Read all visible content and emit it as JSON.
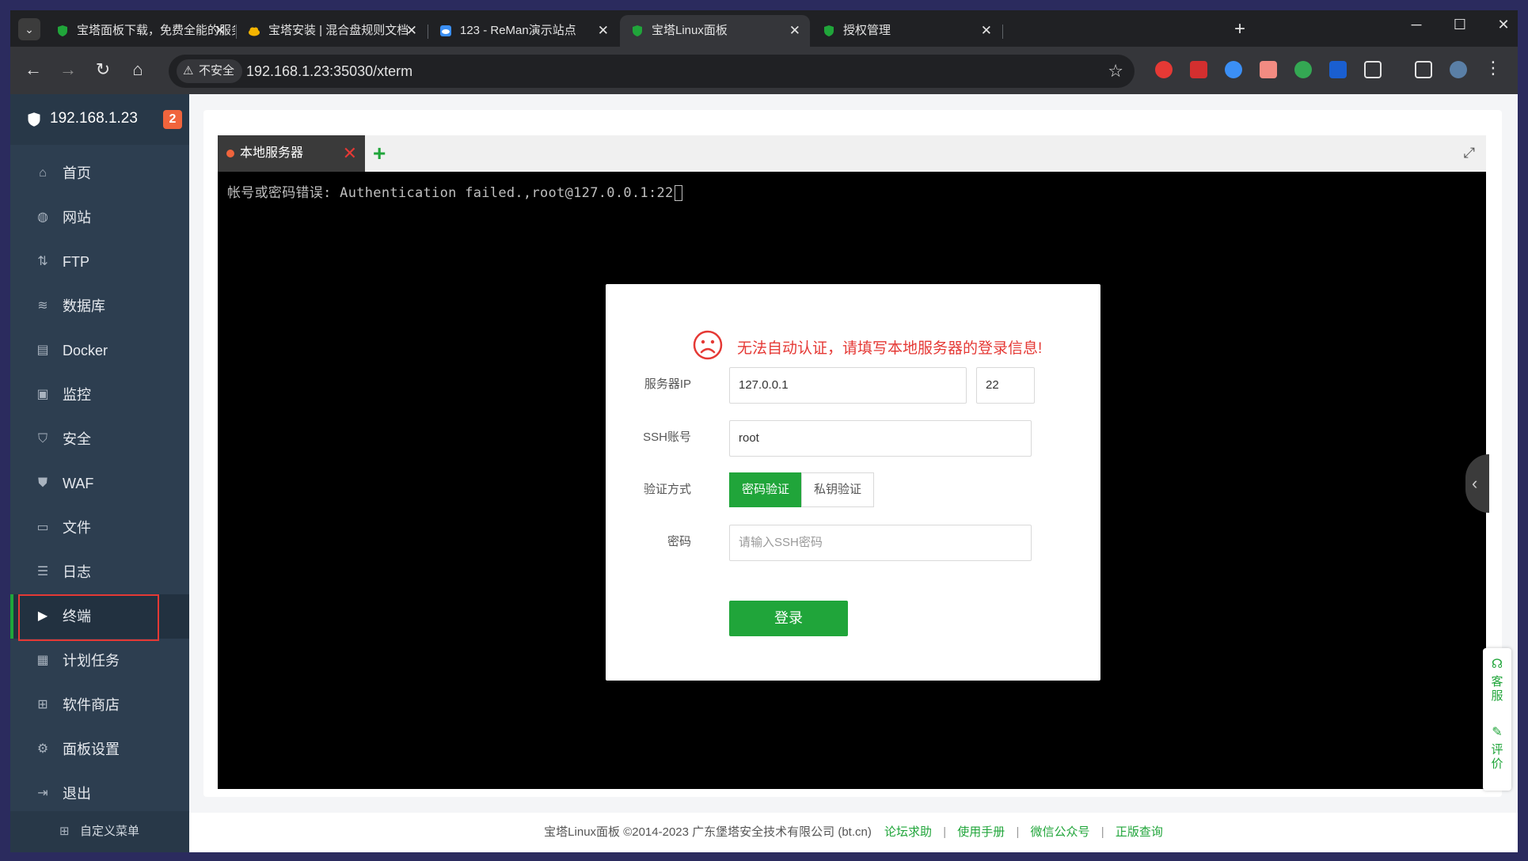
{
  "browser": {
    "tabs": [
      {
        "title": "宝塔面板下载，免费全能的服务",
        "active": false,
        "favicon": "bt-shield-icon"
      },
      {
        "title": "宝塔安装 | 混合盘规则文档",
        "active": false,
        "favicon": "cloud-icon"
      },
      {
        "title": "123 - ReMan演示站点",
        "active": false,
        "favicon": "blue-app-icon"
      },
      {
        "title": "宝塔Linux面板",
        "active": true,
        "favicon": "bt-shield-icon"
      },
      {
        "title": "授权管理",
        "active": false,
        "favicon": "bt-shield-icon"
      }
    ],
    "security_label": "不安全",
    "url": "192.168.1.23:35030/xterm"
  },
  "sidebar": {
    "host": "192.168.1.23",
    "badge": "2",
    "items": [
      {
        "label": "首页",
        "icon": "home-icon"
      },
      {
        "label": "网站",
        "icon": "globe-icon"
      },
      {
        "label": "FTP",
        "icon": "ftp-icon"
      },
      {
        "label": "数据库",
        "icon": "database-icon"
      },
      {
        "label": "Docker",
        "icon": "docker-icon"
      },
      {
        "label": "监控",
        "icon": "monitor-icon"
      },
      {
        "label": "安全",
        "icon": "shield-icon"
      },
      {
        "label": "WAF",
        "icon": "waf-shield-icon"
      },
      {
        "label": "文件",
        "icon": "folder-icon"
      },
      {
        "label": "日志",
        "icon": "log-icon"
      },
      {
        "label": "终端",
        "icon": "terminal-icon",
        "active": true
      },
      {
        "label": "计划任务",
        "icon": "calendar-icon"
      },
      {
        "label": "软件商店",
        "icon": "apps-grid-icon"
      },
      {
        "label": "面板设置",
        "icon": "gear-icon"
      },
      {
        "label": "退出",
        "icon": "logout-icon"
      }
    ],
    "custom_menu": "自定义菜单"
  },
  "terminal": {
    "tab_label": "本地服务器",
    "output": "帐号或密码错误: Authentication failed.,root@127.0.0.1:22"
  },
  "dialog": {
    "message": "无法自动认证，请填写本地服务器的登录信息!",
    "server_ip_label": "服务器IP",
    "server_ip": "127.0.0.1",
    "port": "22",
    "ssh_account_label": "SSH账号",
    "ssh_account": "root",
    "auth_method_label": "验证方式",
    "auth_password": "密码验证",
    "auth_key": "私钥验证",
    "password_label": "密码",
    "password_placeholder": "请输入SSH密码",
    "login_button": "登录"
  },
  "float_bar": {
    "service": "客\n服",
    "review": "评\n价"
  },
  "footer": {
    "copyright": "宝塔Linux面板 ©2014-2023 广东堡塔安全技术有限公司 (bt.cn)",
    "links": [
      "论坛求助",
      "使用手册",
      "微信公众号",
      "正版查询"
    ]
  },
  "colors": {
    "accent": "#20a53a",
    "error": "#e53935",
    "sidebar": "#2d3e50"
  }
}
